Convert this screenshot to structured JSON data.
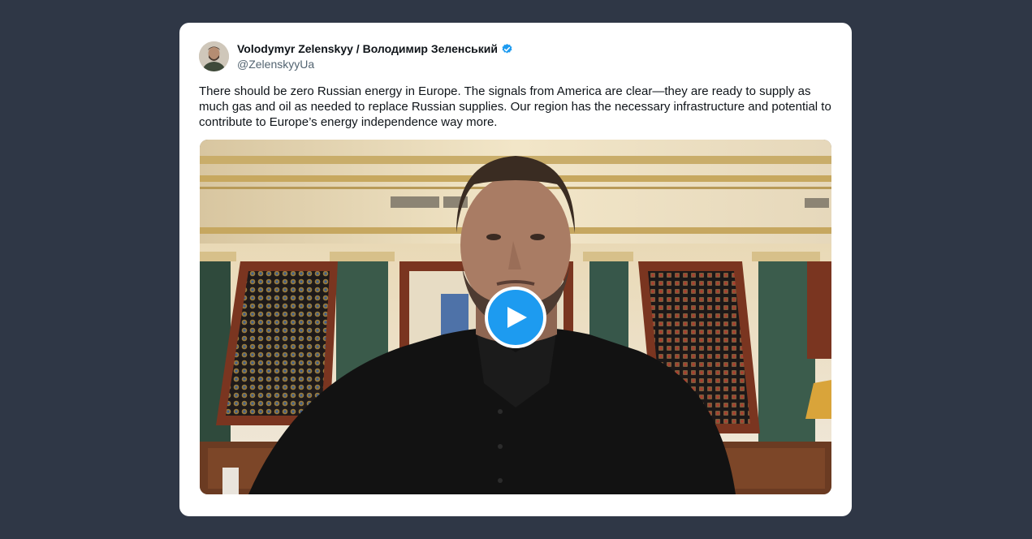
{
  "tweet": {
    "author_name": "Volodymyr Zelenskyy / Володимир Зеленський",
    "handle": "@ZelenskyyUa",
    "verified": true,
    "text": "There should be zero Russian energy in Europe. The signals from America are clear—they are ready to supply as much gas and oil as needed to replace Russian supplies. Our region has the necessary infrastructure and potential to contribute to Europe’s energy independence way more.",
    "media": {
      "type": "video",
      "play_icon": "play-icon"
    }
  },
  "colors": {
    "background": "#2f3746",
    "card": "#ffffff",
    "text": "#0f1419",
    "secondary_text": "#536471",
    "accent": "#1d9bf0"
  }
}
